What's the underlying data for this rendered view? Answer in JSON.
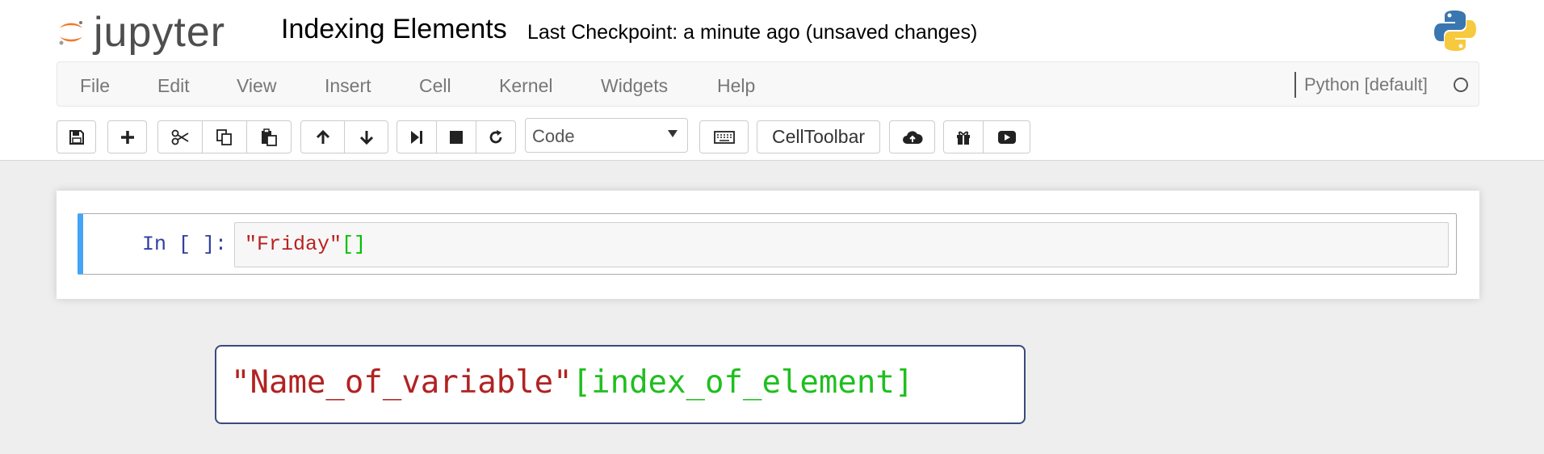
{
  "header": {
    "brand": "jupyter",
    "notebook_title": "Indexing Elements",
    "checkpoint_status": "Last Checkpoint: a minute ago (unsaved changes)",
    "brand_color": "#f37726"
  },
  "menu": {
    "items": [
      "File",
      "Edit",
      "View",
      "Insert",
      "Cell",
      "Kernel",
      "Widgets",
      "Help"
    ]
  },
  "kernel": {
    "name": "Python [default]",
    "status_icon": "kernel-idle-circle-icon"
  },
  "toolbar": {
    "buttons": [
      {
        "name": "save",
        "icon": "save-icon"
      },
      {
        "name": "insert-cell-below",
        "icon": "plus-icon"
      },
      {
        "name": "cut",
        "icon": "scissors-icon"
      },
      {
        "name": "copy",
        "icon": "copy-icon"
      },
      {
        "name": "paste",
        "icon": "paste-icon"
      },
      {
        "name": "move-up",
        "icon": "arrow-up-icon"
      },
      {
        "name": "move-down",
        "icon": "arrow-down-icon"
      },
      {
        "name": "run",
        "icon": "step-forward-icon"
      },
      {
        "name": "interrupt",
        "icon": "stop-icon"
      },
      {
        "name": "restart",
        "icon": "refresh-icon"
      },
      {
        "name": "command-palette",
        "icon": "keyboard-icon"
      },
      {
        "name": "upload",
        "icon": "cloud-upload-icon"
      },
      {
        "name": "gift",
        "icon": "gift-icon"
      },
      {
        "name": "youtube",
        "icon": "play-video-icon"
      }
    ],
    "cell_type_selected": "Code",
    "celltoolbar_label": "CellToolbar"
  },
  "cell": {
    "prompt": "In [ ]:",
    "code_string": "\"Friday\"",
    "code_brackets": "[]",
    "accent_color": "#42a5f5"
  },
  "syntax_overlay": {
    "name_part": "\"Name_of_variable\"",
    "index_part": "[index_of_element]"
  }
}
